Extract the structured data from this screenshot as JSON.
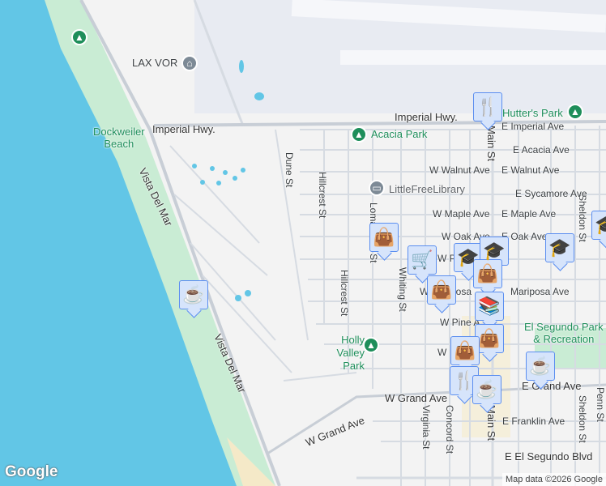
{
  "labels": {
    "lax_vor": "LAX VOR",
    "dockweiler": "Dockweiler\nBeach",
    "imperial_hwy_w": "Imperial Hwy.",
    "imperial_hwy_e": "Imperial Hwy.",
    "vista_del_mar_1": "Vista Del Mar",
    "vista_del_mar_2": "Vista Del Mar",
    "acacia_park": "Acacia Park",
    "hutters_park": "Hutter's Park",
    "little_free_library": "LittleFreeLibrary",
    "holly_valley_park": "Holly Valley Park",
    "el_segundo_park": "El Segundo Park\n& Recreation",
    "dune_st": "Dune St",
    "hillcrest_st_1": "Hillcrest St",
    "hillcrest_st_2": "Hillcrest St",
    "loma_vista_st": "Loma Vista St",
    "whiting_st": "Whiting St",
    "virginia_st": "Virginia St",
    "concord_st": "Concord St",
    "main_st_1": "Main St",
    "main_st_2": "Main St",
    "sheldon_st_1": "Sheldon St",
    "sheldon_st_2": "Sheldon St",
    "penn_st": "Penn St",
    "e_imperial_ave": "E Imperial Ave",
    "e_acacia_ave": "E Acacia Ave",
    "w_walnut_ave": "W Walnut Ave",
    "e_walnut_ave": "E Walnut Ave",
    "e_sycamore_ave": "E Sycamore Ave",
    "w_maple_ave": "W Maple Ave",
    "e_maple_ave": "E Maple Ave",
    "w_oak_ave": "W Oak Ave",
    "e_oak_ave": "E Oak Ave",
    "w_palm_ave": "W P",
    "w_mariposa_ave": "W Mariposa",
    "e_mariposa_ave": "Mariposa Ave",
    "w_pine_ave": "W Pine A",
    "w_holly": "W",
    "w_grand_ave_1": "W Grand Ave",
    "w_grand_ave_2": "W Grand Ave",
    "e_grand_ave": "E Grand Ave",
    "e_franklin_ave": "E Franklin Ave",
    "e_el_segundo_blvd": "E El Segundo Blvd"
  },
  "markers": [
    {
      "type": "restaurant",
      "icon": "🍴"
    },
    {
      "type": "shopping",
      "icon": "👜"
    },
    {
      "type": "grocery",
      "icon": "🛒"
    },
    {
      "type": "school",
      "icon": "🎓"
    },
    {
      "type": "school",
      "icon": "🎓"
    },
    {
      "type": "school",
      "icon": "🎓"
    },
    {
      "type": "school",
      "icon": "🎓"
    },
    {
      "type": "shopping",
      "icon": "👜"
    },
    {
      "type": "shopping",
      "icon": "👜"
    },
    {
      "type": "cafe",
      "icon": "☕"
    },
    {
      "type": "library",
      "icon": "📚"
    },
    {
      "type": "shopping",
      "icon": "👜"
    },
    {
      "type": "shopping",
      "icon": "👜"
    },
    {
      "type": "restaurant",
      "icon": "🍴"
    },
    {
      "type": "cafe",
      "icon": "☕"
    },
    {
      "type": "cafe",
      "icon": "☕"
    }
  ],
  "footer": {
    "google_logo": "Google",
    "attribution": "Map data ©2026 Google"
  },
  "colors": {
    "water": "#62c6e6",
    "park": "#c9ecd4",
    "airport": "#e8ebf2",
    "marker_bg": "#d6e4fb",
    "marker_border": "#5b8ef0",
    "marker_icon": "#0d3a5c"
  }
}
